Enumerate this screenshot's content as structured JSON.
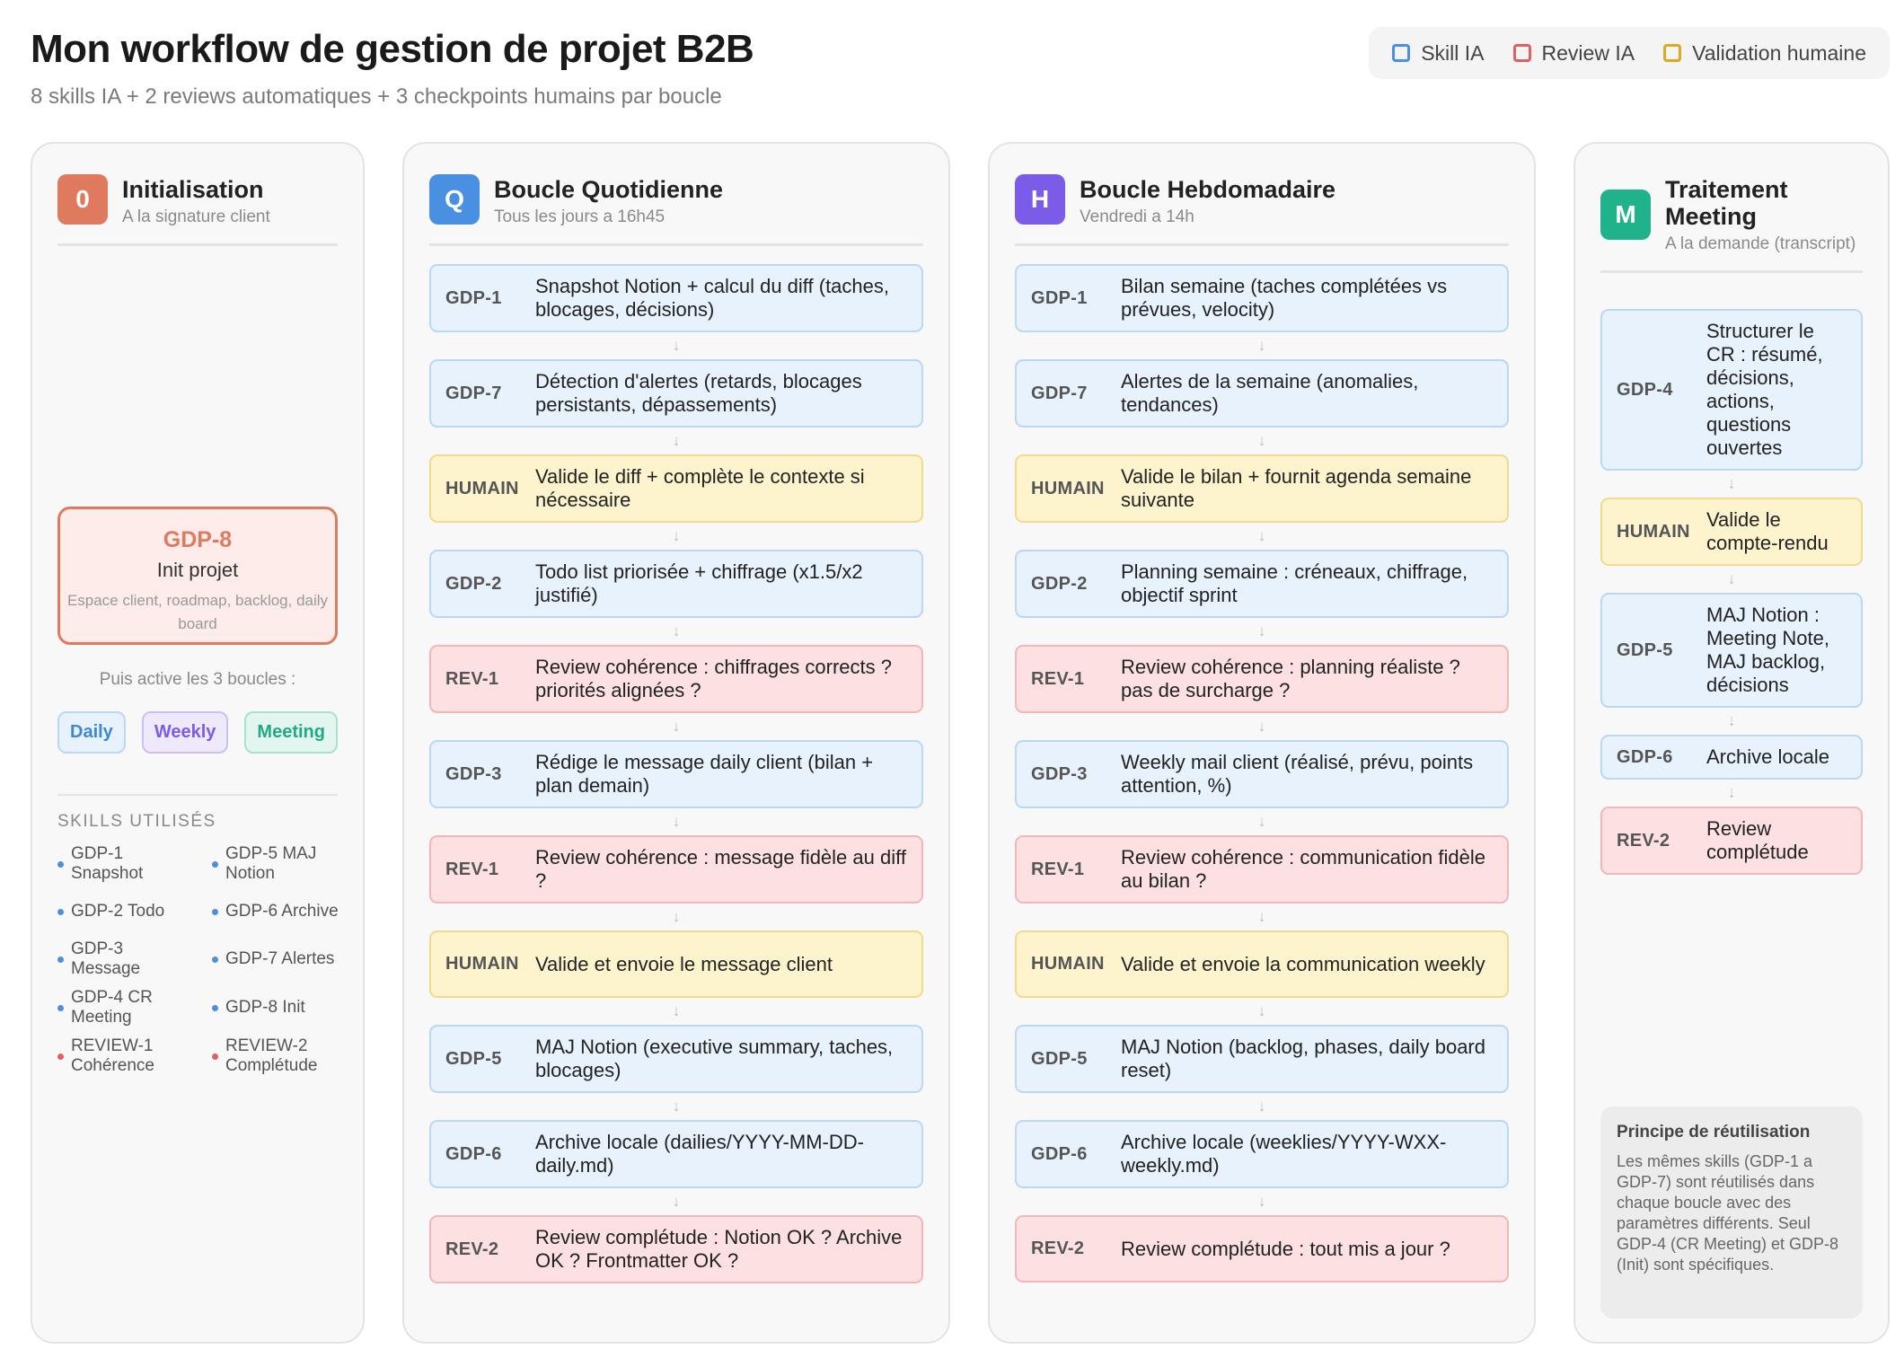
{
  "header": {
    "title": "Mon workflow de gestion de projet B2B",
    "subtitle": "8 skills IA + 2 reviews automatiques + 3 checkpoints humains par boucle"
  },
  "legend": [
    {
      "label": "Skill IA",
      "color": "#4a90e2"
    },
    {
      "label": "Review IA",
      "color": "#e06060"
    },
    {
      "label": "Validation humaine",
      "color": "#d8aa20"
    }
  ],
  "colors": {
    "init": "#e07a5f",
    "daily": "#4a90e2",
    "weekly": "#7a5ce8",
    "meeting": "#20b28a"
  },
  "init": {
    "badge": "0",
    "title": "Initialisation",
    "subtitle": "A la signature client",
    "card_code": "GDP-8",
    "card_name": "Init projet",
    "card_desc": "Espace client, roadmap, backlog, daily board",
    "activate": "Puis active les 3 boucles :",
    "chips": [
      "Daily",
      "Weekly",
      "Meeting"
    ],
    "skills_title": "SKILLS UTILISÉS",
    "skills": [
      {
        "label": "GDP-1 Snapshot",
        "kind": "skill"
      },
      {
        "label": "GDP-5 MAJ Notion",
        "kind": "skill"
      },
      {
        "label": "GDP-2 Todo",
        "kind": "skill"
      },
      {
        "label": "GDP-6 Archive",
        "kind": "skill"
      },
      {
        "label": "GDP-3 Message",
        "kind": "skill"
      },
      {
        "label": "GDP-7 Alertes",
        "kind": "skill"
      },
      {
        "label": "GDP-4 CR Meeting",
        "kind": "skill"
      },
      {
        "label": "GDP-8 Init",
        "kind": "skill"
      },
      {
        "label": "REVIEW-1 Cohérence",
        "kind": "review"
      },
      {
        "label": "REVIEW-2 Complétude",
        "kind": "review"
      }
    ]
  },
  "daily": {
    "badge": "Q",
    "title": "Boucle Quotidienne",
    "subtitle": "Tous les jours a 16h45",
    "steps": [
      {
        "code": "GDP-1",
        "text": "Snapshot Notion + calcul du diff (taches, blocages, décisions)",
        "kind": "skill"
      },
      {
        "code": "GDP-7",
        "text": "Détection d'alertes (retards, blocages persistants, dépassements)",
        "kind": "skill"
      },
      {
        "code": "HUMAIN",
        "text": "Valide le diff + complète le contexte si nécessaire",
        "kind": "human"
      },
      {
        "code": "GDP-2",
        "text": "Todo list priorisée + chiffrage (x1.5/x2 justifié)",
        "kind": "skill"
      },
      {
        "code": "REV-1",
        "text": "Review cohérence : chiffrages corrects ? priorités alignées ?",
        "kind": "review"
      },
      {
        "code": "GDP-3",
        "text": "Rédige le message daily client (bilan + plan demain)",
        "kind": "skill"
      },
      {
        "code": "REV-1",
        "text": "Review cohérence : message fidèle au diff ?",
        "kind": "review"
      },
      {
        "code": "HUMAIN",
        "text": "Valide et envoie le message client",
        "kind": "human"
      },
      {
        "code": "GDP-5",
        "text": "MAJ Notion (executive summary, taches, blocages)",
        "kind": "skill"
      },
      {
        "code": "GDP-6",
        "text": "Archive locale (dailies/YYYY-MM-DD-daily.md)",
        "kind": "skill"
      },
      {
        "code": "REV-2",
        "text": "Review complétude : Notion OK ? Archive OK ? Frontmatter OK ?",
        "kind": "review"
      }
    ]
  },
  "weekly": {
    "badge": "H",
    "title": "Boucle Hebdomadaire",
    "subtitle": "Vendredi a 14h",
    "steps": [
      {
        "code": "GDP-1",
        "text": "Bilan semaine (taches complétées vs prévues, velocity)",
        "kind": "skill"
      },
      {
        "code": "GDP-7",
        "text": "Alertes de la semaine (anomalies, tendances)",
        "kind": "skill"
      },
      {
        "code": "HUMAIN",
        "text": "Valide le bilan + fournit agenda semaine suivante",
        "kind": "human"
      },
      {
        "code": "GDP-2",
        "text": "Planning semaine : créneaux, chiffrage, objectif sprint",
        "kind": "skill"
      },
      {
        "code": "REV-1",
        "text": "Review cohérence : planning réaliste ? pas de surcharge ?",
        "kind": "review"
      },
      {
        "code": "GDP-3",
        "text": "Weekly mail client (réalisé, prévu, points attention, %)",
        "kind": "skill"
      },
      {
        "code": "REV-1",
        "text": "Review cohérence : communication fidèle au bilan ?",
        "kind": "review"
      },
      {
        "code": "HUMAIN",
        "text": "Valide et envoie la communication weekly",
        "kind": "human"
      },
      {
        "code": "GDP-5",
        "text": "MAJ Notion (backlog, phases, daily board reset)",
        "kind": "skill"
      },
      {
        "code": "GDP-6",
        "text": "Archive locale (weeklies/YYYY-WXX-weekly.md)",
        "kind": "skill"
      },
      {
        "code": "REV-2",
        "text": "Review complétude : tout mis a jour ?",
        "kind": "review"
      }
    ]
  },
  "meeting": {
    "badge": "M",
    "title": "Traitement Meeting",
    "subtitle": "A la demande (transcript)",
    "steps": [
      {
        "code": "GDP-4",
        "text": "Structurer le CR : résumé, décisions, actions, questions ouvertes",
        "kind": "skill"
      },
      {
        "code": "HUMAIN",
        "text": "Valide le compte-rendu",
        "kind": "human"
      },
      {
        "code": "GDP-5",
        "text": "MAJ Notion : Meeting Note, MAJ backlog, décisions",
        "kind": "skill"
      },
      {
        "code": "GDP-6",
        "text": "Archive locale",
        "kind": "skill"
      },
      {
        "code": "REV-2",
        "text": "Review complétude",
        "kind": "review"
      }
    ],
    "principle_title": "Principe de réutilisation",
    "principle_text": "Les mêmes skills (GDP-1 a GDP-7) sont réutilisés dans chaque boucle avec des paramètres différents. Seul GDP-4 (CR Meeting) et GDP-8 (Init) sont spécifiques."
  }
}
